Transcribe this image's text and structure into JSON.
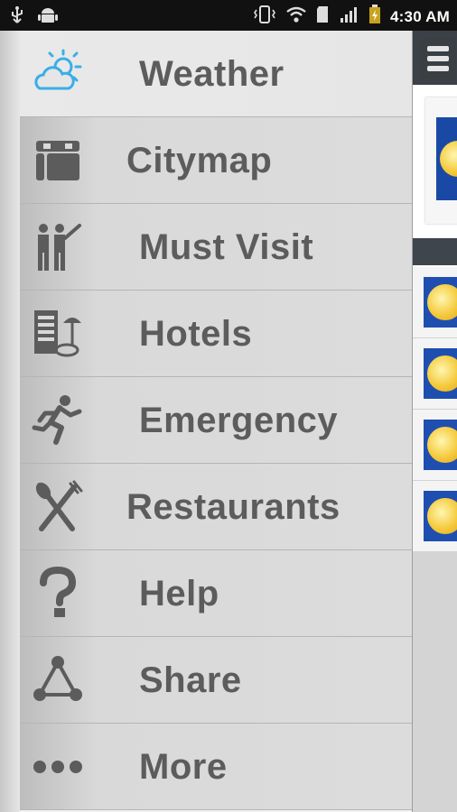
{
  "status_bar": {
    "time": "4:30 AM",
    "icons": [
      "usb-icon",
      "android-icon",
      "vibrate-icon",
      "wifi-icon",
      "sd-card-icon",
      "signal-icon",
      "battery-charging-icon"
    ]
  },
  "drawer": {
    "items": [
      {
        "label": "Weather",
        "icon": "weather-icon"
      },
      {
        "label": "Citymap",
        "icon": "citymap-icon"
      },
      {
        "label": "Must Visit",
        "icon": "must-visit-icon"
      },
      {
        "label": "Hotels",
        "icon": "hotel-icon"
      },
      {
        "label": "Emergency",
        "icon": "emergency-icon"
      },
      {
        "label": "Restaurants",
        "icon": "restaurants-icon"
      },
      {
        "label": "Help",
        "icon": "help-icon"
      },
      {
        "label": "Share",
        "icon": "share-icon"
      },
      {
        "label": "More",
        "icon": "more-icon"
      }
    ],
    "active_index": 0
  },
  "right_panel": {
    "menu_icon": "menu-icon",
    "weather_rows": 4
  },
  "colors": {
    "accent": "#3aaee8",
    "icon_gray": "#5c5c5c",
    "status_bar_bg": "#111111",
    "thumb_blue": "#1e4fb0"
  }
}
